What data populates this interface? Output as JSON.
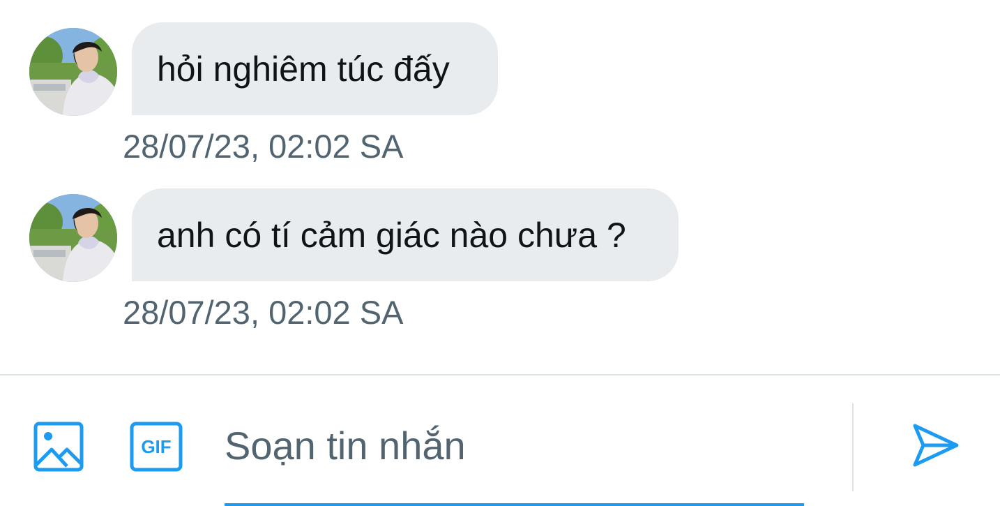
{
  "messages": [
    {
      "text": "hỏi nghiêm túc đấy",
      "timestamp": "28/07/23, 02:02 SA",
      "avatar": "user-avatar"
    },
    {
      "text": "anh có tí cảm giác nào chưa ?",
      "timestamp": "28/07/23, 02:02 SA",
      "avatar": "user-avatar"
    }
  ],
  "composer": {
    "placeholder": "Soạn tin nhắn",
    "value": "",
    "image_icon": "image-icon",
    "gif_icon": "gif-icon",
    "gif_label": "GIF",
    "send_icon": "send-icon"
  },
  "colors": {
    "accent": "#1d9bf0",
    "bubble": "#e8ecef",
    "timestamp": "#536471",
    "text": "#0f1419",
    "divider": "#dde2e6"
  }
}
